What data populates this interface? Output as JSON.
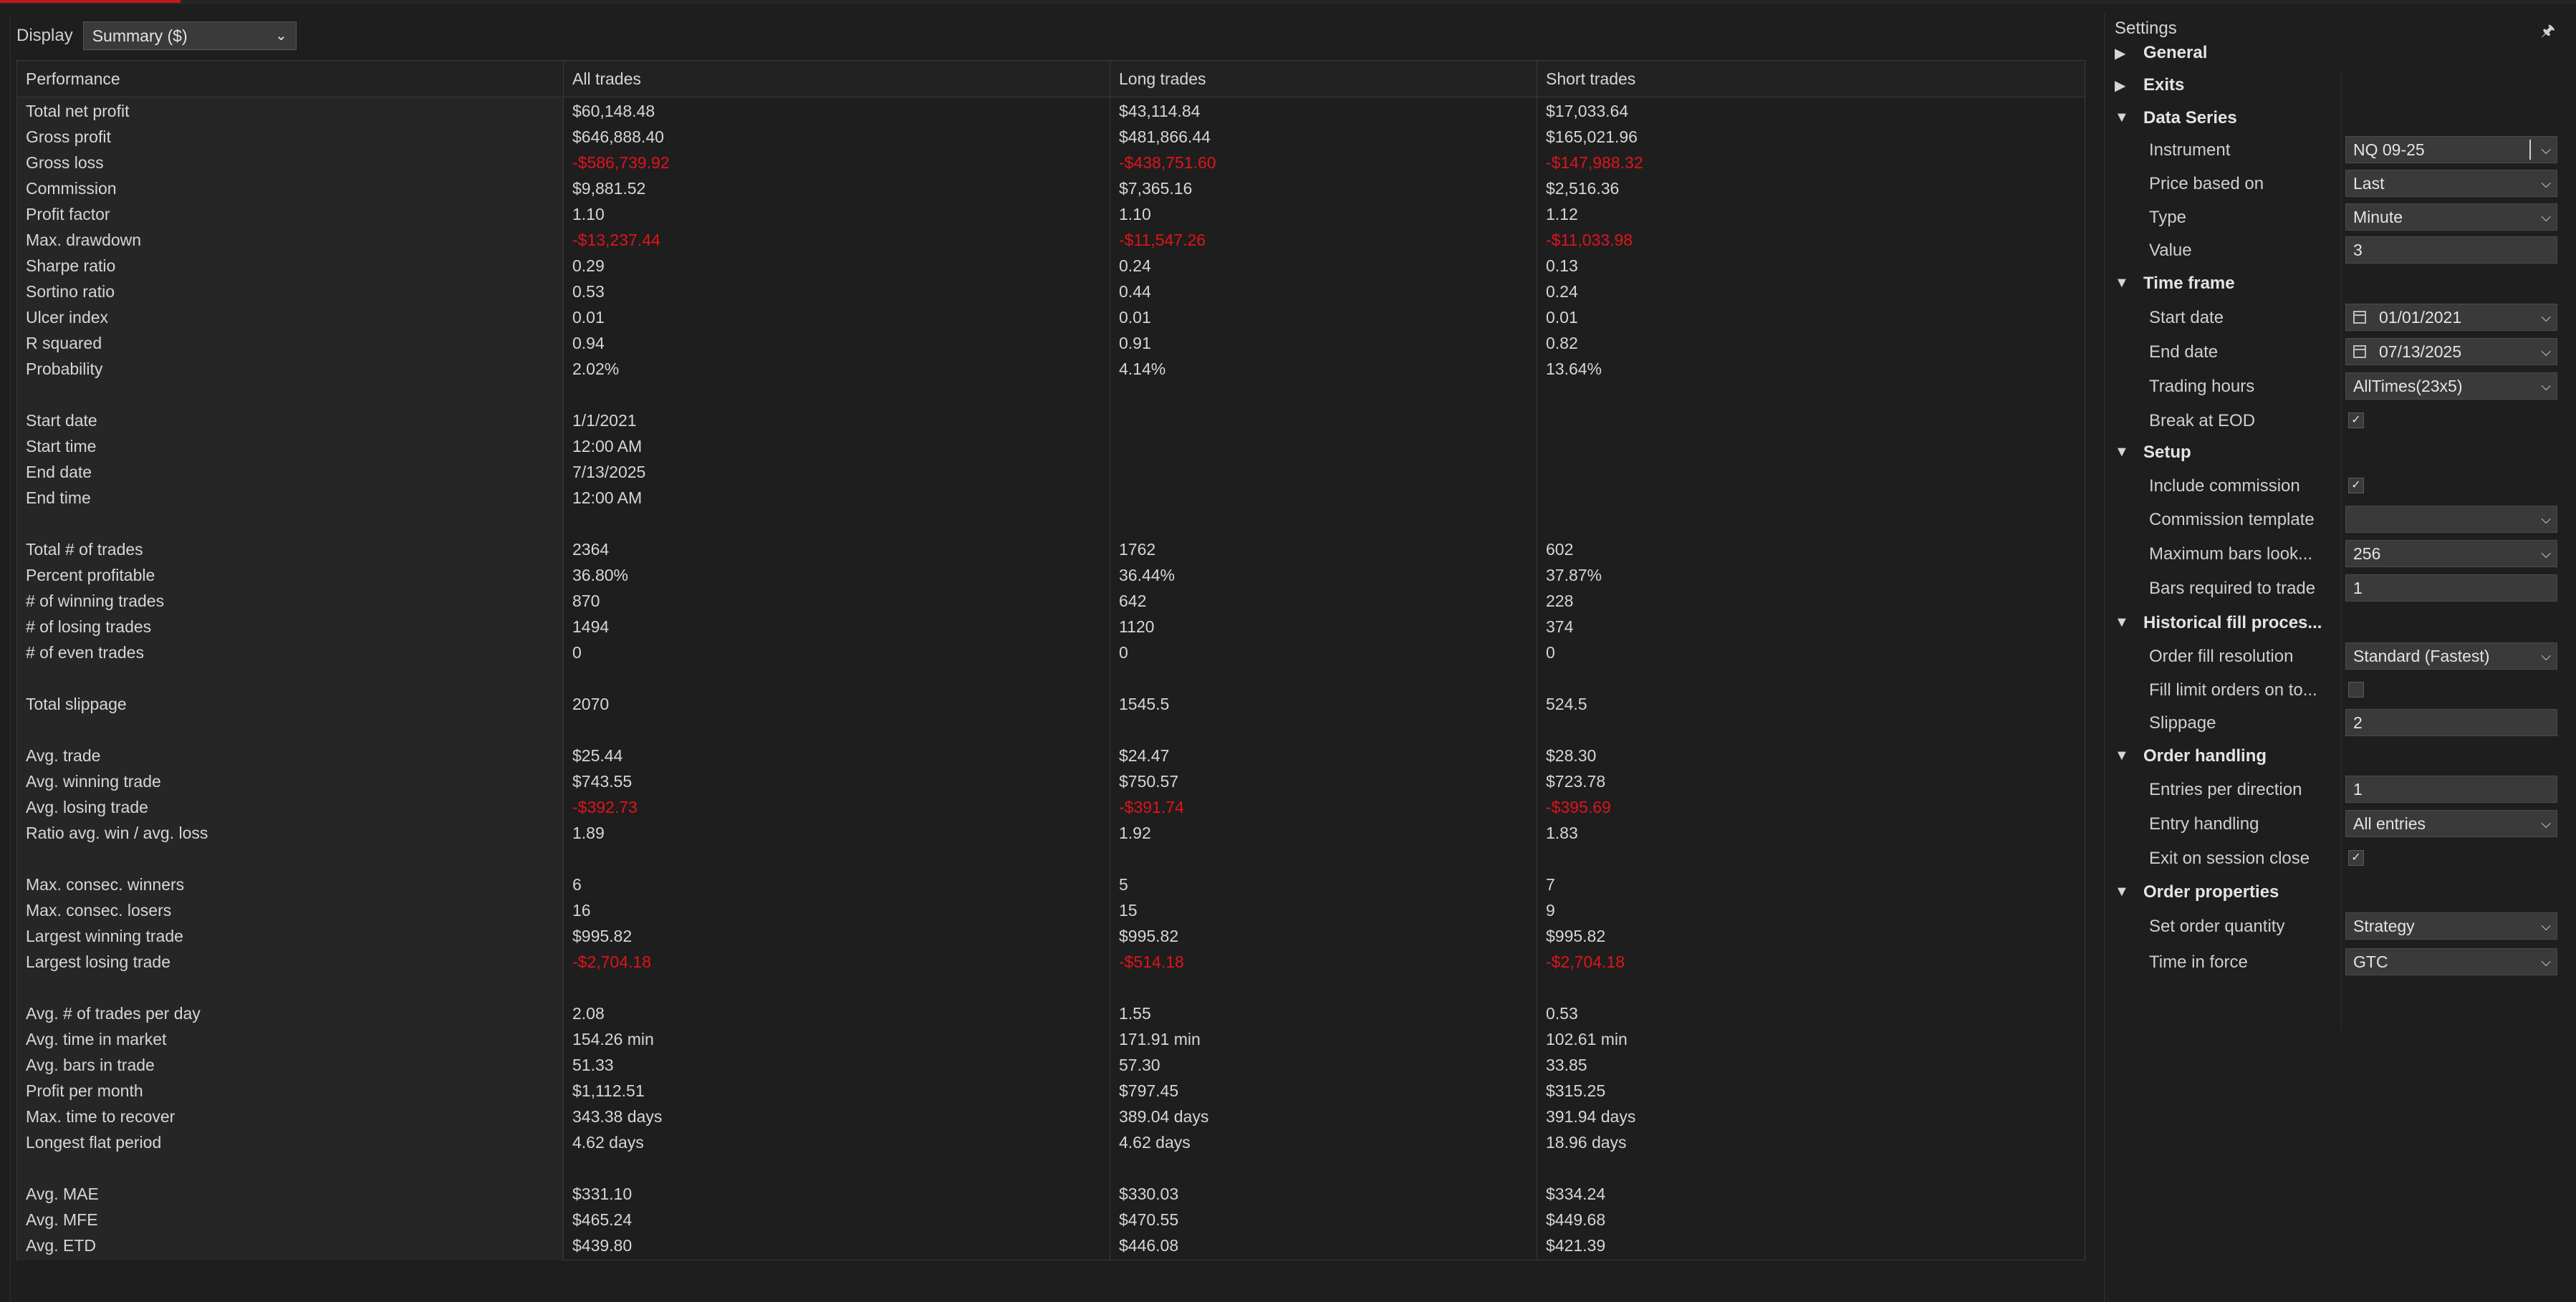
{
  "display": {
    "label": "Display",
    "selected": "Summary ($)"
  },
  "columns": [
    "Performance",
    "All trades",
    "Long trades",
    "Short trades"
  ],
  "rows": [
    {
      "label": "Total net profit",
      "values": [
        "$60,148.48",
        "$43,114.84",
        "$17,033.64"
      ]
    },
    {
      "label": "Gross profit",
      "values": [
        "$646,888.40",
        "$481,866.44",
        "$165,021.96"
      ]
    },
    {
      "label": "Gross loss",
      "values": [
        "-$586,739.92",
        "-$438,751.60",
        "-$147,988.32"
      ],
      "negative": true
    },
    {
      "label": "Commission",
      "values": [
        "$9,881.52",
        "$7,365.16",
        "$2,516.36"
      ]
    },
    {
      "label": "Profit factor",
      "values": [
        "1.10",
        "1.10",
        "1.12"
      ]
    },
    {
      "label": "Max. drawdown",
      "values": [
        "-$13,237.44",
        "-$11,547.26",
        "-$11,033.98"
      ],
      "negative": true
    },
    {
      "label": "Sharpe ratio",
      "values": [
        "0.29",
        "0.24",
        "0.13"
      ]
    },
    {
      "label": "Sortino ratio",
      "values": [
        "0.53",
        "0.44",
        "0.24"
      ]
    },
    {
      "label": "Ulcer index",
      "values": [
        "0.01",
        "0.01",
        "0.01"
      ]
    },
    {
      "label": "R squared",
      "values": [
        "0.94",
        "0.91",
        "0.82"
      ]
    },
    {
      "label": "Probability",
      "values": [
        "2.02%",
        "4.14%",
        "13.64%"
      ]
    },
    {
      "label": "",
      "values": [
        "",
        "",
        ""
      ]
    },
    {
      "label": "Start date",
      "values": [
        "1/1/2021",
        "",
        ""
      ]
    },
    {
      "label": "Start time",
      "values": [
        "12:00 AM",
        "",
        ""
      ]
    },
    {
      "label": "End date",
      "values": [
        "7/13/2025",
        "",
        ""
      ]
    },
    {
      "label": "End time",
      "values": [
        "12:00 AM",
        "",
        ""
      ]
    },
    {
      "label": "",
      "values": [
        "",
        "",
        ""
      ]
    },
    {
      "label": "Total # of trades",
      "values": [
        "2364",
        "1762",
        "602"
      ]
    },
    {
      "label": "Percent profitable",
      "values": [
        "36.80%",
        "36.44%",
        "37.87%"
      ]
    },
    {
      "label": "# of winning trades",
      "values": [
        "870",
        "642",
        "228"
      ]
    },
    {
      "label": "# of losing trades",
      "values": [
        "1494",
        "1120",
        "374"
      ]
    },
    {
      "label": "# of even trades",
      "values": [
        "0",
        "0",
        "0"
      ]
    },
    {
      "label": "",
      "values": [
        "",
        "",
        ""
      ]
    },
    {
      "label": "Total slippage",
      "values": [
        "2070",
        "1545.5",
        "524.5"
      ]
    },
    {
      "label": "",
      "values": [
        "",
        "",
        ""
      ]
    },
    {
      "label": "Avg. trade",
      "values": [
        "$25.44",
        "$24.47",
        "$28.30"
      ]
    },
    {
      "label": "Avg. winning trade",
      "values": [
        "$743.55",
        "$750.57",
        "$723.78"
      ]
    },
    {
      "label": "Avg. losing trade",
      "values": [
        "-$392.73",
        "-$391.74",
        "-$395.69"
      ],
      "negative": true
    },
    {
      "label": "Ratio avg. win / avg. loss",
      "values": [
        "1.89",
        "1.92",
        "1.83"
      ]
    },
    {
      "label": "",
      "values": [
        "",
        "",
        ""
      ]
    },
    {
      "label": "Max. consec. winners",
      "values": [
        "6",
        "5",
        "7"
      ]
    },
    {
      "label": "Max. consec. losers",
      "values": [
        "16",
        "15",
        "9"
      ]
    },
    {
      "label": "Largest winning trade",
      "values": [
        "$995.82",
        "$995.82",
        "$995.82"
      ]
    },
    {
      "label": "Largest losing trade",
      "values": [
        "-$2,704.18",
        "-$514.18",
        "-$2,704.18"
      ],
      "negative": true
    },
    {
      "label": "",
      "values": [
        "",
        "",
        ""
      ]
    },
    {
      "label": "Avg. # of trades per day",
      "values": [
        "2.08",
        "1.55",
        "0.53"
      ]
    },
    {
      "label": "Avg. time in market",
      "values": [
        "154.26 min",
        "171.91 min",
        "102.61 min"
      ]
    },
    {
      "label": "Avg. bars in trade",
      "values": [
        "51.33",
        "57.30",
        "33.85"
      ]
    },
    {
      "label": "Profit per month",
      "values": [
        "$1,112.51",
        "$797.45",
        "$315.25"
      ]
    },
    {
      "label": "Max. time to recover",
      "values": [
        "343.38 days",
        "389.04 days",
        "391.94 days"
      ]
    },
    {
      "label": "Longest flat period",
      "values": [
        "4.62 days",
        "4.62 days",
        "18.96 days"
      ]
    },
    {
      "label": "",
      "values": [
        "",
        "",
        ""
      ]
    },
    {
      "label": "Avg. MAE",
      "values": [
        "$331.10",
        "$330.03",
        "$334.24"
      ]
    },
    {
      "label": "Avg. MFE",
      "values": [
        "$465.24",
        "$470.55",
        "$449.68"
      ]
    },
    {
      "label": "Avg. ETD",
      "values": [
        "$439.80",
        "$446.08",
        "$421.39"
      ]
    }
  ],
  "settings": {
    "title": "Settings",
    "items": [
      {
        "kind": "section",
        "label": "General",
        "expanded": false
      },
      {
        "kind": "section",
        "label": "Exits",
        "expanded": false
      },
      {
        "kind": "section",
        "label": "Data Series",
        "expanded": true
      },
      {
        "kind": "dropdown",
        "label": "Instrument",
        "value": "NQ 09-25",
        "editable": true
      },
      {
        "kind": "dropdown",
        "label": "Price based on",
        "value": "Last"
      },
      {
        "kind": "dropdown",
        "label": "Type",
        "value": "Minute"
      },
      {
        "kind": "text",
        "label": "Value",
        "value": "3"
      },
      {
        "kind": "section",
        "label": "Time frame",
        "expanded": true
      },
      {
        "kind": "date",
        "label": "Start date",
        "value": "01/01/2021"
      },
      {
        "kind": "date",
        "label": "End date",
        "value": "07/13/2025"
      },
      {
        "kind": "dropdown",
        "label": "Trading hours",
        "value": "AllTimes(23x5)"
      },
      {
        "kind": "checkbox",
        "label": "Break at EOD",
        "checked": true
      },
      {
        "kind": "section",
        "label": "Setup",
        "expanded": true
      },
      {
        "kind": "checkbox",
        "label": "Include commission",
        "checked": true
      },
      {
        "kind": "dropdown",
        "label": "Commission template",
        "value": ""
      },
      {
        "kind": "dropdown",
        "label": "Maximum bars look...",
        "value": "256"
      },
      {
        "kind": "text",
        "label": "Bars required to trade",
        "value": "1"
      },
      {
        "kind": "section",
        "label": "Historical fill proces...",
        "expanded": true
      },
      {
        "kind": "dropdown",
        "label": "Order fill resolution",
        "value": "Standard (Fastest)"
      },
      {
        "kind": "checkbox",
        "label": "Fill limit orders on to...",
        "checked": false
      },
      {
        "kind": "text",
        "label": "Slippage",
        "value": "2"
      },
      {
        "kind": "section",
        "label": "Order handling",
        "expanded": true
      },
      {
        "kind": "text",
        "label": "Entries per direction",
        "value": "1"
      },
      {
        "kind": "dropdown",
        "label": "Entry handling",
        "value": "All entries"
      },
      {
        "kind": "checkbox",
        "label": "Exit on session close",
        "checked": true
      },
      {
        "kind": "section",
        "label": "Order properties",
        "expanded": true
      },
      {
        "kind": "dropdown",
        "label": "Set order quantity",
        "value": "Strategy"
      },
      {
        "kind": "dropdown",
        "label": "Time in force",
        "value": "GTC"
      }
    ]
  },
  "icons": {
    "expanded": "triangle-down-icon",
    "collapsed": "triangle-right-icon",
    "pin": "pin-icon",
    "calendar": "calendar-icon",
    "check": "check-icon"
  },
  "colors": {
    "negative": "#e0141a",
    "accent": "#c2181b"
  }
}
